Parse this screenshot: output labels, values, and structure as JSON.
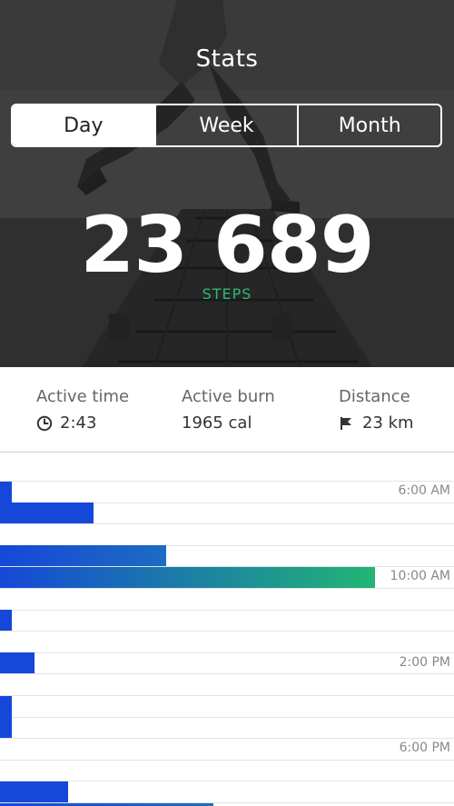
{
  "header": {
    "title": "Stats"
  },
  "tabs": [
    {
      "label": "Day",
      "active": true
    },
    {
      "label": "Week",
      "active": false
    },
    {
      "label": "Month",
      "active": false
    }
  ],
  "steps": {
    "value": "23 689",
    "label": "STEPS"
  },
  "stats": {
    "active_time": {
      "label": "Active time",
      "value": "2:43",
      "icon": "clock-icon"
    },
    "active_burn": {
      "label": "Active burn",
      "value": "1965 cal"
    },
    "distance": {
      "label": "Distance",
      "value": "23 km",
      "icon": "flag-icon"
    }
  },
  "colors": {
    "accent_green": "#2fb873",
    "bar_blue": "#1548d8",
    "bar_gradient_end": "#22b574"
  },
  "chart_data": {
    "type": "bar",
    "orientation": "horizontal",
    "time_labels": [
      "6:00 AM",
      "10:00 AM",
      "2:00 PM",
      "6:00 PM"
    ],
    "values": [
      0.025,
      0.205,
      0,
      0.365,
      0.825,
      0,
      0.025,
      0,
      0.075,
      0,
      0.025,
      0.025,
      0,
      0,
      0.15,
      0.47
    ],
    "xlim": [
      0,
      1
    ]
  }
}
